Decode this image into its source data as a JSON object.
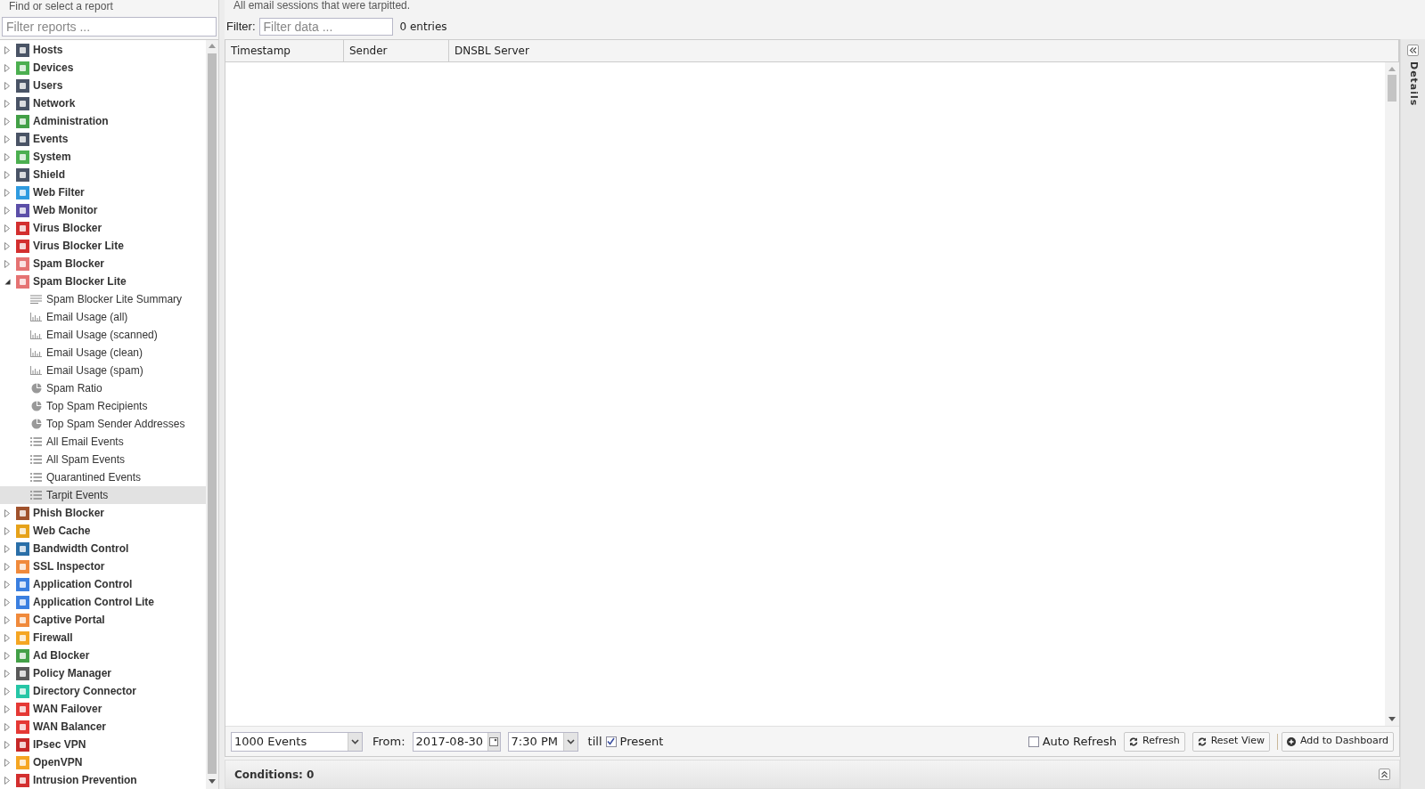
{
  "sidebar": {
    "title": "Find or select a report",
    "filter_placeholder": "Filter reports ...",
    "items": [
      {
        "label": "Hosts",
        "color": "#4a5466",
        "expanded": false
      },
      {
        "label": "Devices",
        "color": "#4caf50",
        "expanded": false
      },
      {
        "label": "Users",
        "color": "#4a5466",
        "expanded": false
      },
      {
        "label": "Network",
        "color": "#4a5466",
        "expanded": false
      },
      {
        "label": "Administration",
        "color": "#43a047",
        "expanded": false
      },
      {
        "label": "Events",
        "color": "#4a5466",
        "expanded": false
      },
      {
        "label": "System",
        "color": "#4caf50",
        "expanded": false
      },
      {
        "label": "Shield",
        "color": "#4a5466",
        "expanded": false
      },
      {
        "label": "Web Filter",
        "color": "#2f9be0",
        "expanded": false
      },
      {
        "label": "Web Monitor",
        "color": "#5c4fa8",
        "expanded": false
      },
      {
        "label": "Virus Blocker",
        "color": "#d32f2f",
        "expanded": false
      },
      {
        "label": "Virus Blocker Lite",
        "color": "#d32f2f",
        "expanded": false
      },
      {
        "label": "Spam Blocker",
        "color": "#e57373",
        "expanded": false
      },
      {
        "label": "Spam Blocker Lite",
        "color": "#e57373",
        "expanded": true,
        "children": [
          {
            "label": "Spam Blocker Lite Summary",
            "kind": "text",
            "selected": false
          },
          {
            "label": "Email Usage (all)",
            "kind": "bar",
            "selected": false
          },
          {
            "label": "Email Usage (scanned)",
            "kind": "bar",
            "selected": false
          },
          {
            "label": "Email Usage (clean)",
            "kind": "bar",
            "selected": false
          },
          {
            "label": "Email Usage (spam)",
            "kind": "bar",
            "selected": false
          },
          {
            "label": "Spam Ratio",
            "kind": "pie",
            "selected": false
          },
          {
            "label": "Top Spam Recipients",
            "kind": "pie",
            "selected": false
          },
          {
            "label": "Top Spam Sender Addresses",
            "kind": "pie",
            "selected": false
          },
          {
            "label": "All Email Events",
            "kind": "list",
            "selected": false
          },
          {
            "label": "All Spam Events",
            "kind": "list",
            "selected": false
          },
          {
            "label": "Quarantined Events",
            "kind": "list",
            "selected": false
          },
          {
            "label": "Tarpit Events",
            "kind": "list",
            "selected": true
          }
        ]
      },
      {
        "label": "Phish Blocker",
        "color": "#a0522d",
        "expanded": false
      },
      {
        "label": "Web Cache",
        "color": "#e6a21a",
        "expanded": false
      },
      {
        "label": "Bandwidth Control",
        "color": "#2a6fa8",
        "expanded": false
      },
      {
        "label": "SSL Inspector",
        "color": "#f08a3c",
        "expanded": false
      },
      {
        "label": "Application Control",
        "color": "#3b7fe0",
        "expanded": false
      },
      {
        "label": "Application Control Lite",
        "color": "#3b7fe0",
        "expanded": false
      },
      {
        "label": "Captive Portal",
        "color": "#f08a3c",
        "expanded": false
      },
      {
        "label": "Firewall",
        "color": "#f5a623",
        "expanded": false
      },
      {
        "label": "Ad Blocker",
        "color": "#43a047",
        "expanded": false
      },
      {
        "label": "Policy Manager",
        "color": "#5a5a5a",
        "expanded": false
      },
      {
        "label": "Directory Connector",
        "color": "#26c6a6",
        "expanded": false
      },
      {
        "label": "WAN Failover",
        "color": "#e53935",
        "expanded": false
      },
      {
        "label": "WAN Balancer",
        "color": "#e53935",
        "expanded": false
      },
      {
        "label": "IPsec VPN",
        "color": "#c62828",
        "expanded": false
      },
      {
        "label": "OpenVPN",
        "color": "#f5a623",
        "expanded": false
      },
      {
        "label": "Intrusion Prevention",
        "color": "#d32f2f",
        "expanded": false
      }
    ]
  },
  "report": {
    "description": "All email sessions that were tarpitted.",
    "filter_label": "Filter:",
    "filter_placeholder": "Filter data ...",
    "entries": "0 entries",
    "columns": [
      "Timestamp",
      "Sender",
      "DNSBL Server"
    ]
  },
  "toolbar": {
    "limit": "1000 Events",
    "from_label": "From:",
    "date": "2017-08-30",
    "time": "7:30 PM",
    "till_label": "till",
    "present": {
      "label": "Present",
      "checked": true
    },
    "auto_refresh": {
      "label": "Auto Refresh",
      "checked": false
    },
    "refresh": "Refresh",
    "reset_view": "Reset View",
    "add_to_dashboard": "Add to Dashboard"
  },
  "conditions": "Conditions: 0",
  "details_panel": {
    "title": "Details"
  }
}
